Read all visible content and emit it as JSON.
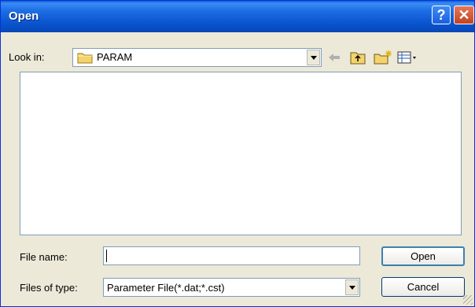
{
  "window": {
    "title": "Open",
    "help_glyph": "?",
    "close_glyph": "✕"
  },
  "look_in": {
    "label": "Look in:",
    "value": "PARAM",
    "folder_icon": "folder-icon"
  },
  "toolbar": {
    "back": "back-arrow-icon",
    "up": "up-one-level-icon",
    "new_folder": "new-folder-icon",
    "views": "views-menu-icon"
  },
  "file_name": {
    "label": "File name:",
    "value": ""
  },
  "file_type": {
    "label": "Files of type:",
    "value": "Parameter File(*.dat;*.cst)"
  },
  "buttons": {
    "open": "Open",
    "cancel": "Cancel"
  },
  "colors": {
    "titlebar": "#0a55d0",
    "dialog": "#ece9d8",
    "field_border": "#7f9db9"
  }
}
